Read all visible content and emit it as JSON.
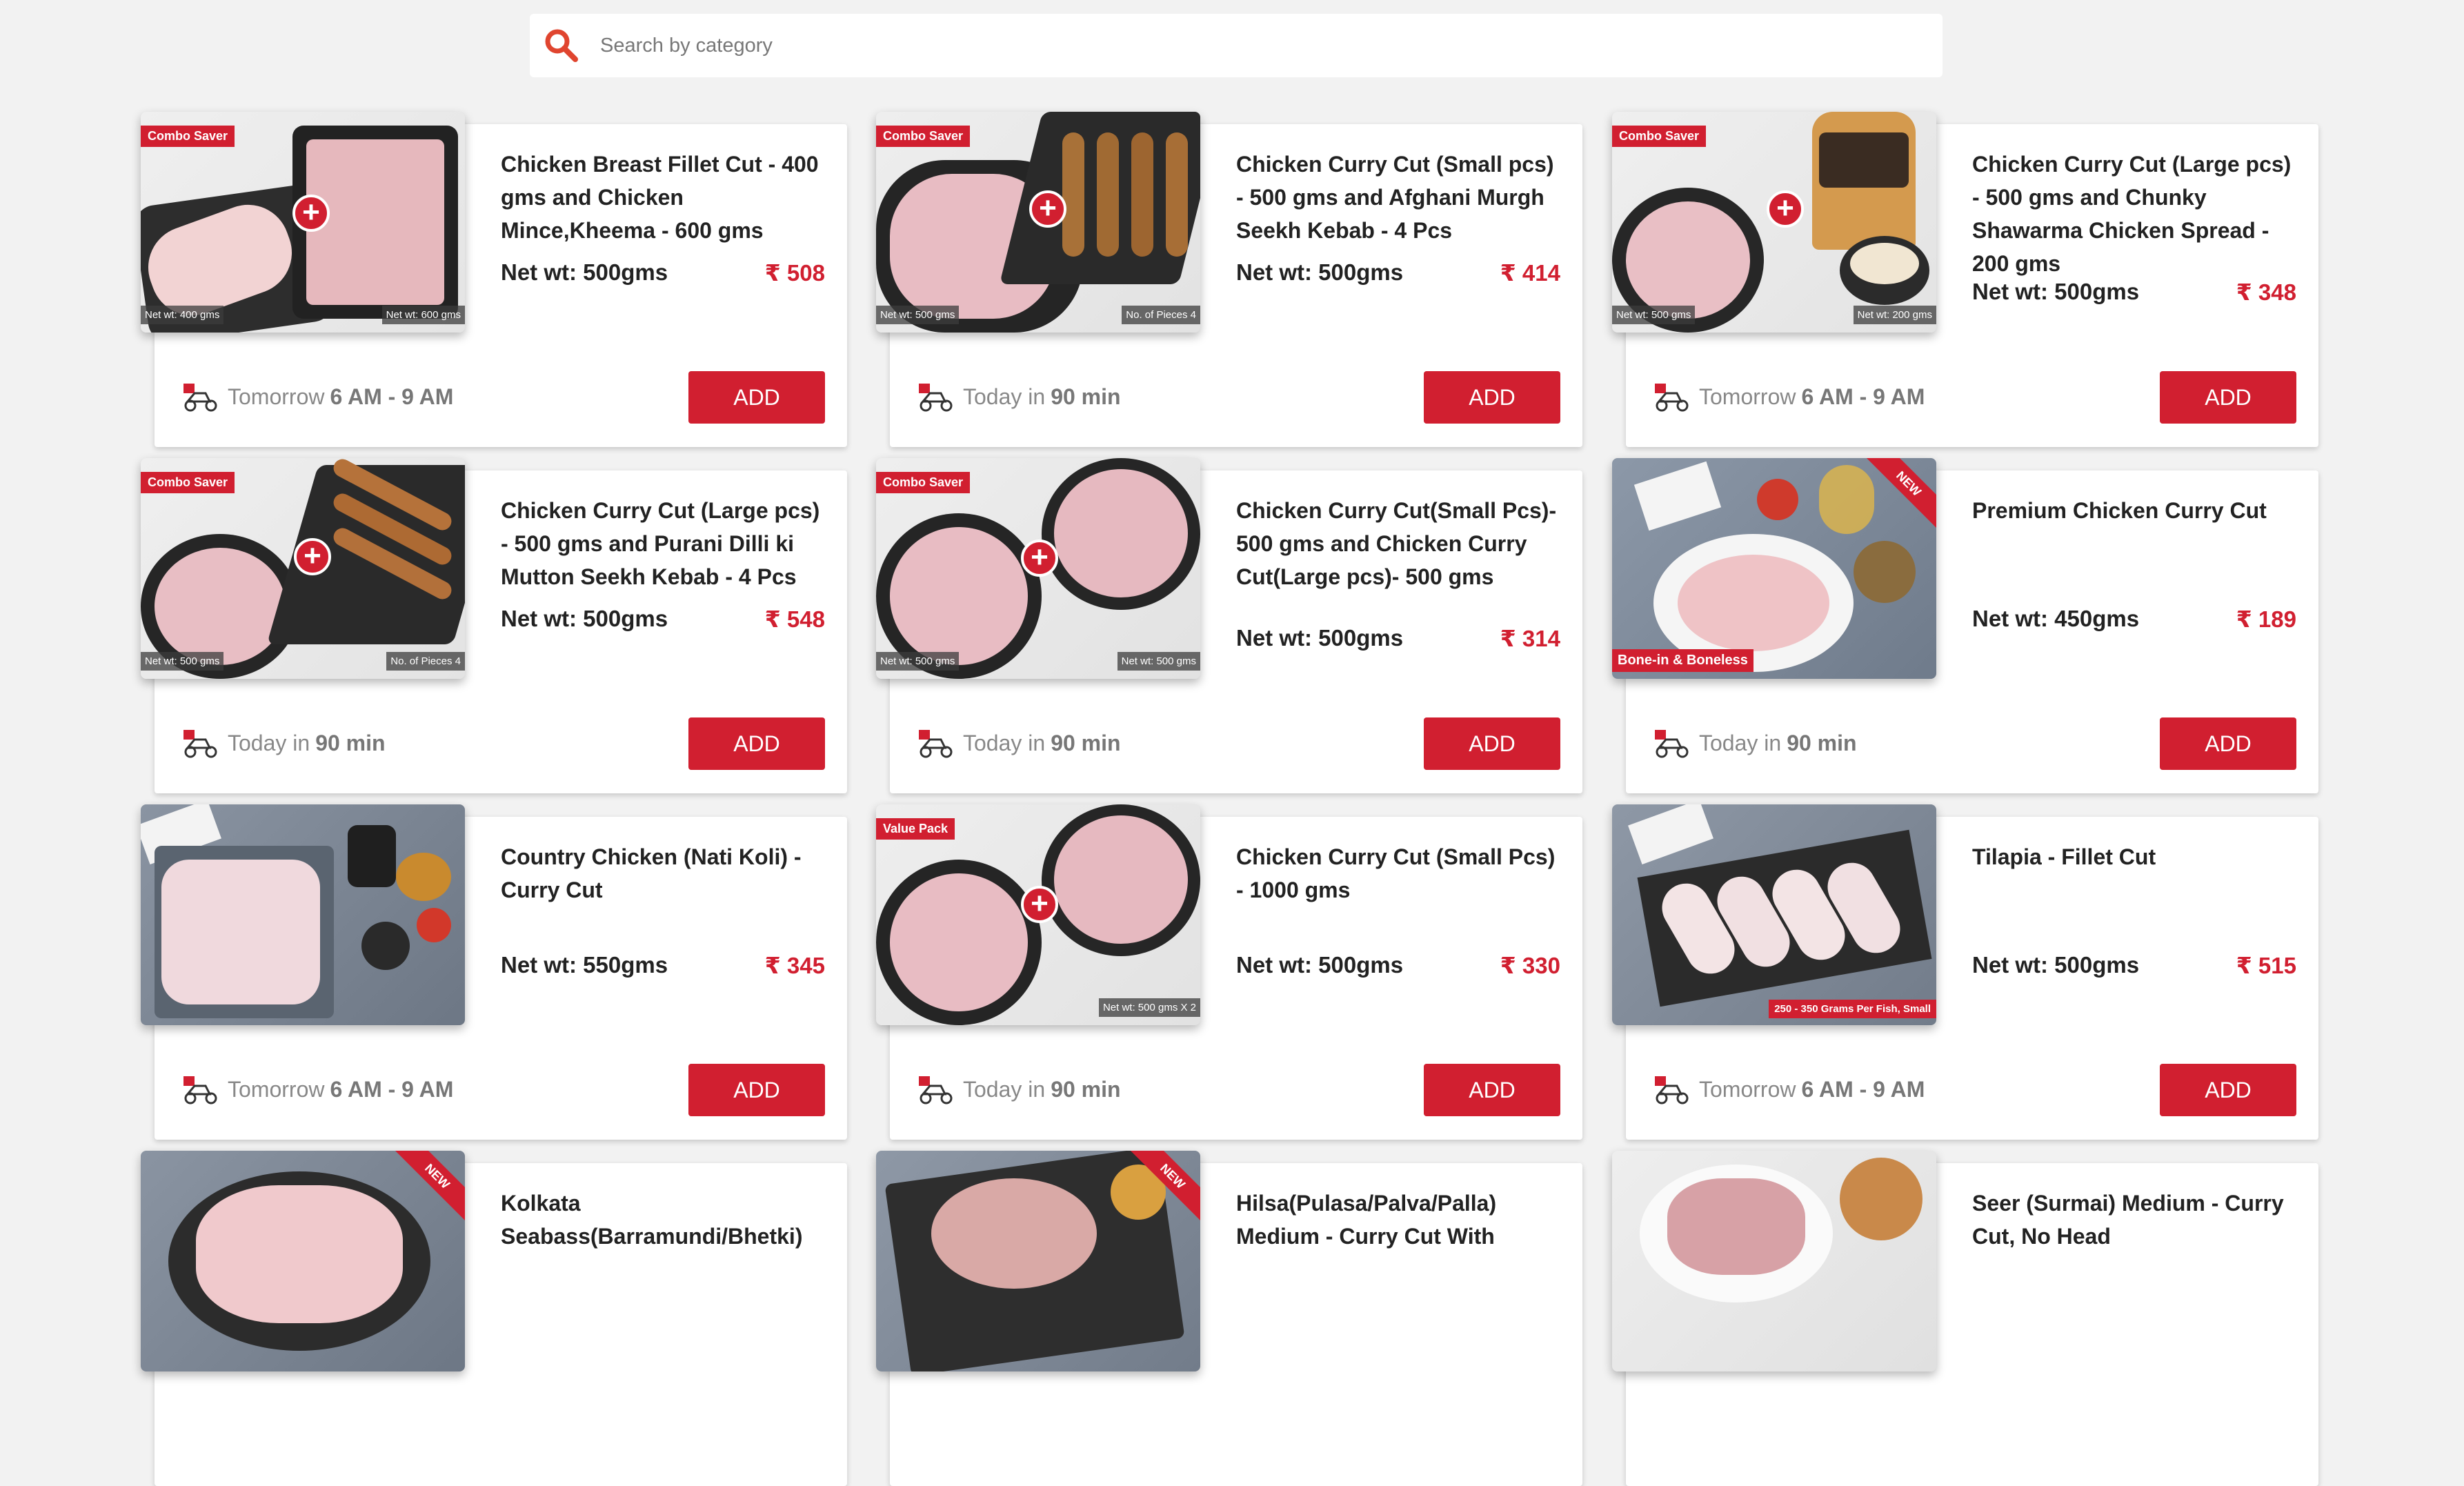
{
  "search": {
    "placeholder": "Search by category"
  },
  "common": {
    "add_label": "ADD",
    "rupee": "₹"
  },
  "colors": {
    "accent": "#d11f30",
    "page_bg": "#f2f2f2",
    "card_bg": "#ffffff"
  },
  "products": [
    {
      "title": "Chicken Breast Fillet Cut - 400 gms and Chicken Mince,Kheema - 600 gms",
      "net_wt": "Net wt: 500gms",
      "price": "₹ 508",
      "delivery_prefix": "Tomorrow",
      "delivery_time": "6 AM - 9 AM",
      "badge": "Combo Saver",
      "tag_left": "Net wt: 400 gms",
      "tag_right": "Net wt: 600 gms"
    },
    {
      "title": "Chicken Curry Cut (Small pcs) - 500 gms and Afghani Murgh Seekh Kebab - 4 Pcs",
      "net_wt": "Net wt: 500gms",
      "price": "₹ 414",
      "delivery_prefix": "Today in",
      "delivery_time": "90 min",
      "badge": "Combo Saver",
      "tag_left": "Net wt: 500 gms",
      "tag_right": "No. of Pieces 4"
    },
    {
      "title": "Chicken Curry Cut (Large pcs) - 500 gms and Chunky Shawarma Chicken Spread - 200 gms",
      "net_wt": "Net wt: 500gms",
      "price": "₹ 348",
      "delivery_prefix": "Tomorrow",
      "delivery_time": "6 AM - 9 AM",
      "badge": "Combo Saver",
      "tag_left": "Net wt: 500 gms",
      "tag_right": "Net wt: 200 gms"
    },
    {
      "title": "Chicken Curry Cut (Large pcs) - 500 gms and Purani Dilli ki Mutton Seekh Kebab - 4 Pcs",
      "net_wt": "Net wt: 500gms",
      "price": "₹ 548",
      "delivery_prefix": "Today in",
      "delivery_time": "90 min",
      "badge": "Combo Saver",
      "tag_left": "Net wt: 500 gms",
      "tag_right": "No. of Pieces 4"
    },
    {
      "title": "Chicken Curry Cut(Small Pcs)- 500 gms and Chicken Curry Cut(Large pcs)- 500 gms",
      "net_wt": "Net wt: 500gms",
      "price": "₹ 314",
      "delivery_prefix": "Today in",
      "delivery_time": "90 min",
      "badge": "Combo Saver",
      "tag_left": "Net wt: 500 gms",
      "tag_right": "Net wt: 500 gms"
    },
    {
      "title": "Premium Chicken Curry Cut",
      "net_wt": "Net wt: 450gms",
      "price": "₹ 189",
      "delivery_prefix": "Today in",
      "delivery_time": "90 min",
      "ribbon": "NEW",
      "bottom_tag": "Bone-in & Boneless"
    },
    {
      "title": "Country Chicken (Nati Koli) - Curry Cut",
      "net_wt": "Net wt: 550gms",
      "price": "₹ 345",
      "delivery_prefix": "Tomorrow",
      "delivery_time": "6 AM - 9 AM"
    },
    {
      "title": "Chicken Curry Cut (Small Pcs) - 1000 gms",
      "net_wt": "Net wt: 500gms",
      "price": "₹ 330",
      "delivery_prefix": "Today in",
      "delivery_time": "90 min",
      "badge": "Value Pack",
      "tag_right": "Net wt: 500 gms X 2"
    },
    {
      "title": "Tilapia - Fillet Cut",
      "net_wt": "Net wt: 500gms",
      "price": "₹ 515",
      "delivery_prefix": "Tomorrow",
      "delivery_time": "6 AM - 9 AM",
      "red_tag": "250 - 350 Grams Per Fish, Small"
    },
    {
      "title": "Kolkata Seabass(Barramundi/Bhetki)",
      "ribbon": "NEW"
    },
    {
      "title": "Hilsa(Pulasa/Palva/Palla) Medium - Curry Cut With",
      "ribbon": "NEW"
    },
    {
      "title": "Seer (Surmai) Medium - Curry Cut, No Head"
    }
  ]
}
